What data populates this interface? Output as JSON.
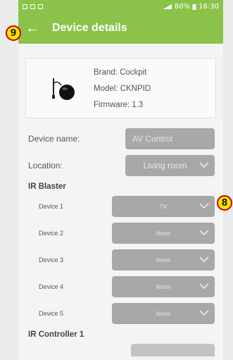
{
  "status_bar": {
    "battery": "80%",
    "time": "16:30"
  },
  "app_bar": {
    "title": "Device details",
    "back_icon": "back-arrow-icon"
  },
  "device_info": {
    "brand": "Brand: Cockpit",
    "model": "Model: CKNPID",
    "firmware": "Firmware: 1.3"
  },
  "fields": {
    "device_name": {
      "label": "Device name:",
      "value": "AV Control"
    },
    "location": {
      "label": "Location:",
      "value": "Living room"
    }
  },
  "ir_blaster": {
    "title": "IR Blaster",
    "devices": [
      {
        "label": "Device 1",
        "value": "TV"
      },
      {
        "label": "Device 2",
        "value": "None"
      },
      {
        "label": "Device 3",
        "value": "None"
      },
      {
        "label": "Device 4",
        "value": "None"
      },
      {
        "label": "Device 5",
        "value": "None"
      }
    ]
  },
  "ir_controller": {
    "title": "IR Controller 1"
  },
  "callouts": {
    "back": "9",
    "device1": "8"
  },
  "colors": {
    "appbar": "#8bc34a",
    "field": "#a8a8a8",
    "callout_fill": "#ffe600",
    "callout_border": "#cc0000"
  }
}
